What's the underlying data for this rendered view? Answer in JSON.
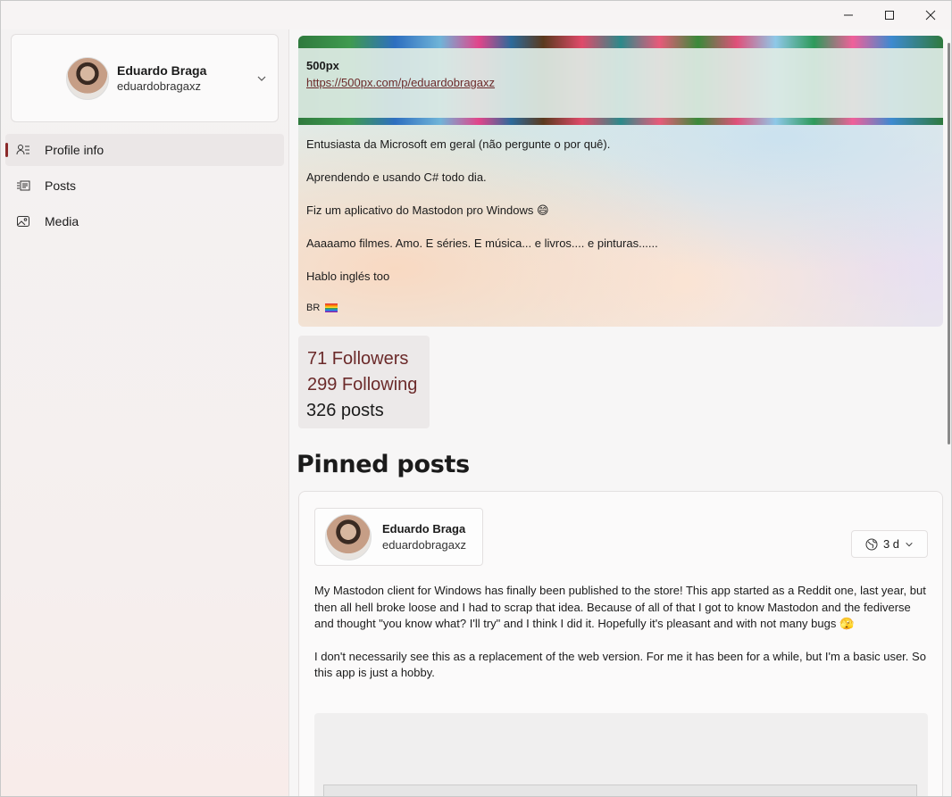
{
  "window": {
    "controls": {
      "minimize_icon": "minimize-icon",
      "maximize_icon": "maximize-icon",
      "close_icon": "close-icon"
    }
  },
  "account": {
    "name": "Eduardo Braga",
    "handle": "eduardobragaxz"
  },
  "nav": {
    "items": [
      {
        "label": "Profile info",
        "icon": "profile-info-icon"
      },
      {
        "label": "Posts",
        "icon": "posts-icon"
      },
      {
        "label": "Media",
        "icon": "media-icon"
      }
    ]
  },
  "profile": {
    "field_name": "500px",
    "field_link": "https://500px.com/p/eduardobragaxz",
    "bio": [
      "Entusiasta da Microsoft em geral (não pergunte o por quê).",
      "Aprendendo e usando C# todo dia.",
      "Fiz um aplicativo do Mastodon pro Windows 😄",
      "Aaaaamo filmes. Amo. E séries. E música... e livros.... e pinturas......",
      "Hablo inglés too"
    ],
    "flags": "BR",
    "followers": "71 Followers",
    "following": "299 Following",
    "posts": "326 posts"
  },
  "pinned": {
    "title": "Pinned posts",
    "post": {
      "author_name": "Eduardo Braga",
      "author_handle": "eduardobragaxz",
      "time": "3 d",
      "paragraphs": [
        "My Mastodon client for Windows has finally been published to the store! This app started as a Reddit one, last year, but then all hell broke loose and I had to scrap that idea. Because of all of that I got to know Mastodon and the fediverse and thought \"you know what? I'll try\" and I think I did it. Hopefully it's pleasant and with not many bugs 🫣",
        "I don't necessarily see this as a replacement of the web version. For me it has been for a while, but I'm a basic user. So this app is just a hobby."
      ]
    }
  },
  "colors": {
    "accent": "#6b2a2a",
    "nav_indicator": "#8b2a2a"
  }
}
